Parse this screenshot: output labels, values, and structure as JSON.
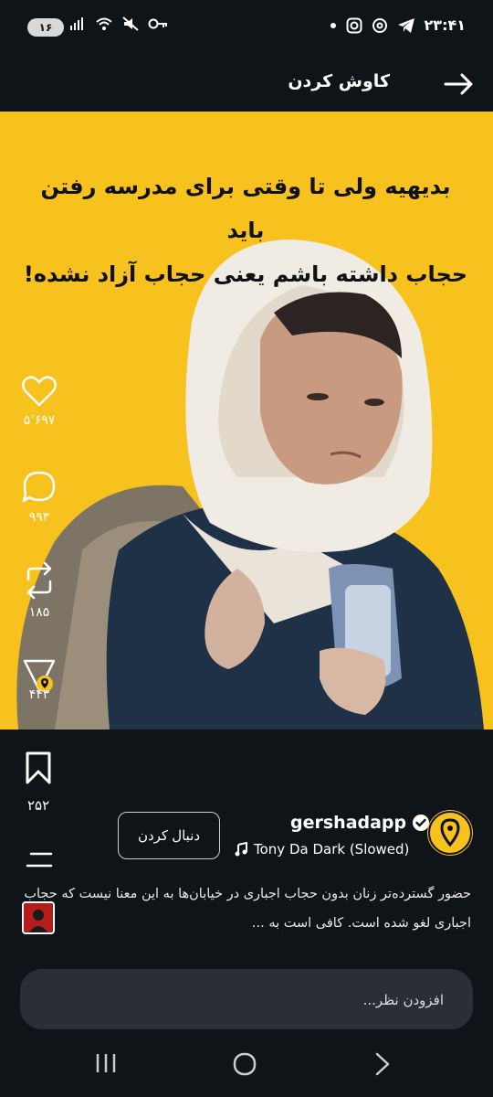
{
  "status_bar": {
    "battery": "۱۶",
    "time": "۲۳:۴۱"
  },
  "header": {
    "title": "کاوش کردن"
  },
  "post": {
    "headline_line1": "بدیهیه ولی تا وقتی برای مدرسه رفتن باید",
    "headline_line2": "حجاب داشته باشم یعنی حجاب آزاد نشده!",
    "likes": "۵٬۶۹۷",
    "comments": "۹۹۳",
    "reposts": "۱۸۵",
    "shares": "۴۴۳",
    "bookmarks": "۲۵۲",
    "username": "gershadapp",
    "follow_label": "دنبال کردن",
    "song": "Tony Da  Dark (Slowed)",
    "caption": "حضور گسترده‌تر زنان بدون حجاب اجباری در خیابان‌ها به این معنا نیست که حجاب اجباری لغو شده است. کافی است به ..."
  },
  "comment_box": {
    "placeholder": "افزودن نظر..."
  },
  "colors": {
    "background": "#0f1419",
    "accent_yellow": "#f7c21e"
  }
}
